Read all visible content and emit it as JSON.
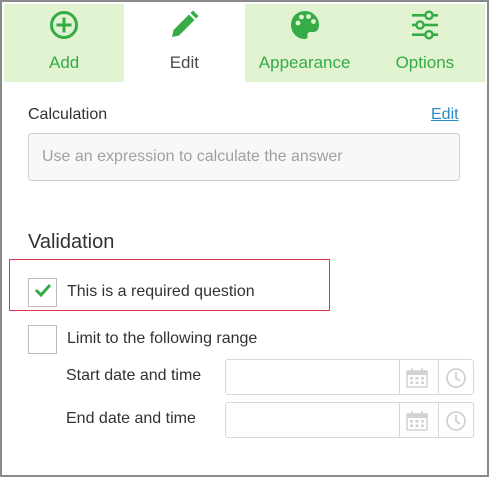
{
  "tabs": [
    {
      "label": "Add",
      "icon": "add-circle-icon"
    },
    {
      "label": "Edit",
      "icon": "pencil-icon"
    },
    {
      "label": "Appearance",
      "icon": "palette-icon"
    },
    {
      "label": "Options",
      "icon": "sliders-icon"
    }
  ],
  "active_tab": "Edit",
  "calculation": {
    "label": "Calculation",
    "edit_link": "Edit",
    "placeholder": "Use an expression to calculate the answer"
  },
  "validation": {
    "title": "Validation",
    "required": {
      "label": "This is a required question",
      "checked": true
    },
    "limit_range": {
      "label": "Limit to the following range",
      "checked": false
    },
    "start": {
      "label": "Start date and time",
      "value": ""
    },
    "end": {
      "label": "End date and time",
      "value": ""
    }
  },
  "colors": {
    "accent_green": "#35ac46",
    "tab_background": "#e1f3d1",
    "link_blue": "#2d8ac7",
    "highlight_red": "#e0384a"
  }
}
